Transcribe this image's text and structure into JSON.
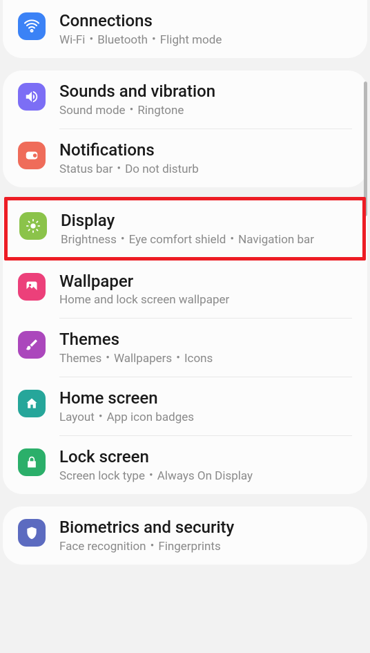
{
  "groups": [
    {
      "items": [
        {
          "id": "connections",
          "title": "Connections",
          "subtitle_parts": [
            "Wi-Fi",
            "Bluetooth",
            "Flight mode"
          ],
          "icon": "wifi",
          "color": "#3b82f6"
        }
      ]
    },
    {
      "items": [
        {
          "id": "sounds",
          "title": "Sounds and vibration",
          "subtitle_parts": [
            "Sound mode",
            "Ringtone"
          ],
          "icon": "speaker",
          "color": "#7c6ef5"
        },
        {
          "id": "notifications",
          "title": "Notifications",
          "subtitle_parts": [
            "Status bar",
            "Do not disturb"
          ],
          "icon": "notif",
          "color": "#ef6c5a"
        }
      ]
    },
    {
      "items": [
        {
          "id": "display",
          "title": "Display",
          "subtitle_parts": [
            "Brightness",
            "Eye comfort shield",
            "Navigation bar"
          ],
          "icon": "brightness",
          "color": "#8bc34a",
          "highlighted": true
        },
        {
          "id": "wallpaper",
          "title": "Wallpaper",
          "subtitle_parts": [
            "Home and lock screen wallpaper"
          ],
          "icon": "image",
          "color": "#ec407a"
        },
        {
          "id": "themes",
          "title": "Themes",
          "subtitle_parts": [
            "Themes",
            "Wallpapers",
            "Icons"
          ],
          "icon": "brush",
          "color": "#ab47bc"
        },
        {
          "id": "homescreen",
          "title": "Home screen",
          "subtitle_parts": [
            "Layout",
            "App icon badges"
          ],
          "icon": "home",
          "color": "#26a69a"
        },
        {
          "id": "lockscreen",
          "title": "Lock screen",
          "subtitle_parts": [
            "Screen lock type",
            "Always On Display"
          ],
          "icon": "lock",
          "color": "#2baf6a"
        }
      ]
    },
    {
      "items": [
        {
          "id": "biometrics",
          "title": "Biometrics and security",
          "subtitle_parts": [
            "Face recognition",
            "Fingerprints"
          ],
          "icon": "shield",
          "color": "#5c6bc0"
        }
      ]
    }
  ]
}
